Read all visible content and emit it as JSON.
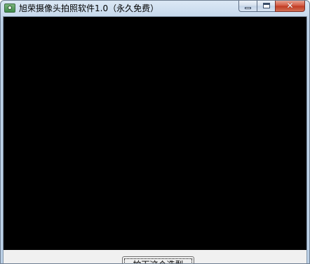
{
  "window": {
    "title": "旭荣摄像头拍照软件1.0（永久免费）",
    "icon": "camera-app-icon",
    "controls": {
      "minimize_icon": "minimize-icon",
      "maximize_icon": "maximize-icon",
      "close_icon": "close-icon",
      "close_glyph": "✕"
    }
  },
  "preview": {
    "background": "#000000"
  },
  "actions": {
    "capture_label": "拍下这个造型"
  },
  "colors": {
    "title_bar": "#c7d9ec",
    "client_background": "#f0f0f0",
    "close_button": "#c03a21"
  }
}
